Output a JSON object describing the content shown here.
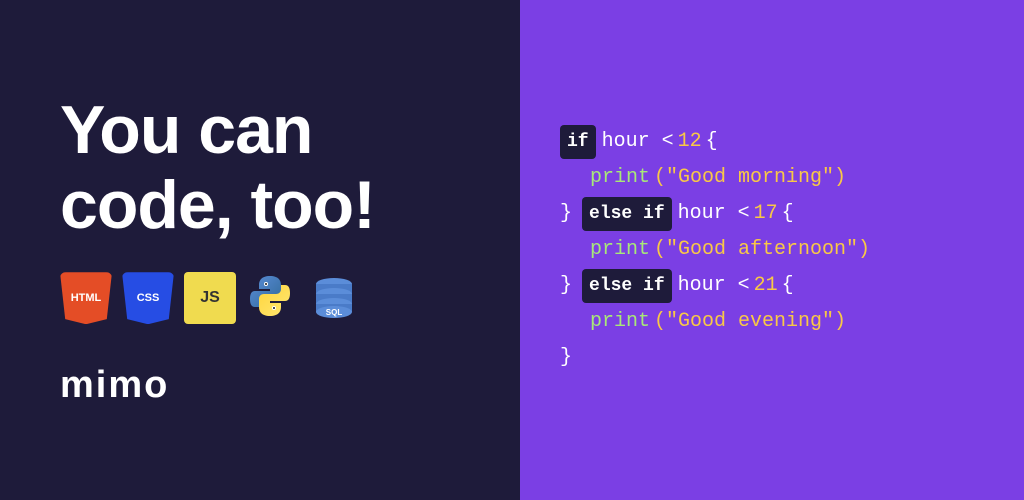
{
  "left": {
    "headline_line1": "You can",
    "headline_line2": "code, too!",
    "logo": "mimo",
    "tech_icons": [
      {
        "label": "HTML",
        "type": "html"
      },
      {
        "label": "CSS",
        "type": "css"
      },
      {
        "label": "JS",
        "type": "js"
      },
      {
        "label": "Python",
        "type": "python"
      },
      {
        "label": "SQL",
        "type": "sql"
      }
    ]
  },
  "right": {
    "code_lines": [
      {
        "type": "if_line",
        "keyword": "if",
        "text": " hour < ",
        "num": "12",
        "brace": " {"
      },
      {
        "type": "print_line",
        "indent": true,
        "fn": "print",
        "str": "(\"Good morning\")"
      },
      {
        "type": "else_if_line",
        "close": "} ",
        "keyword": "else if",
        "text": " hour < ",
        "num": "17",
        "brace": " {"
      },
      {
        "type": "print_line",
        "indent": true,
        "fn": "print",
        "str": "(\"Good afternoon\")"
      },
      {
        "type": "else_if_line",
        "close": "} ",
        "keyword": "else if",
        "text": " hour < ",
        "num": "21",
        "brace": " {"
      },
      {
        "type": "print_line",
        "indent": true,
        "fn": "print",
        "str": "(\"Good evening\")"
      },
      {
        "type": "close_line",
        "text": "}"
      }
    ]
  },
  "colors": {
    "bg_dark": "#1e1b3a",
    "bg_purple": "#7b3fe4",
    "white": "#ffffff",
    "yellow": "#f9c846",
    "green": "#a8e878"
  }
}
